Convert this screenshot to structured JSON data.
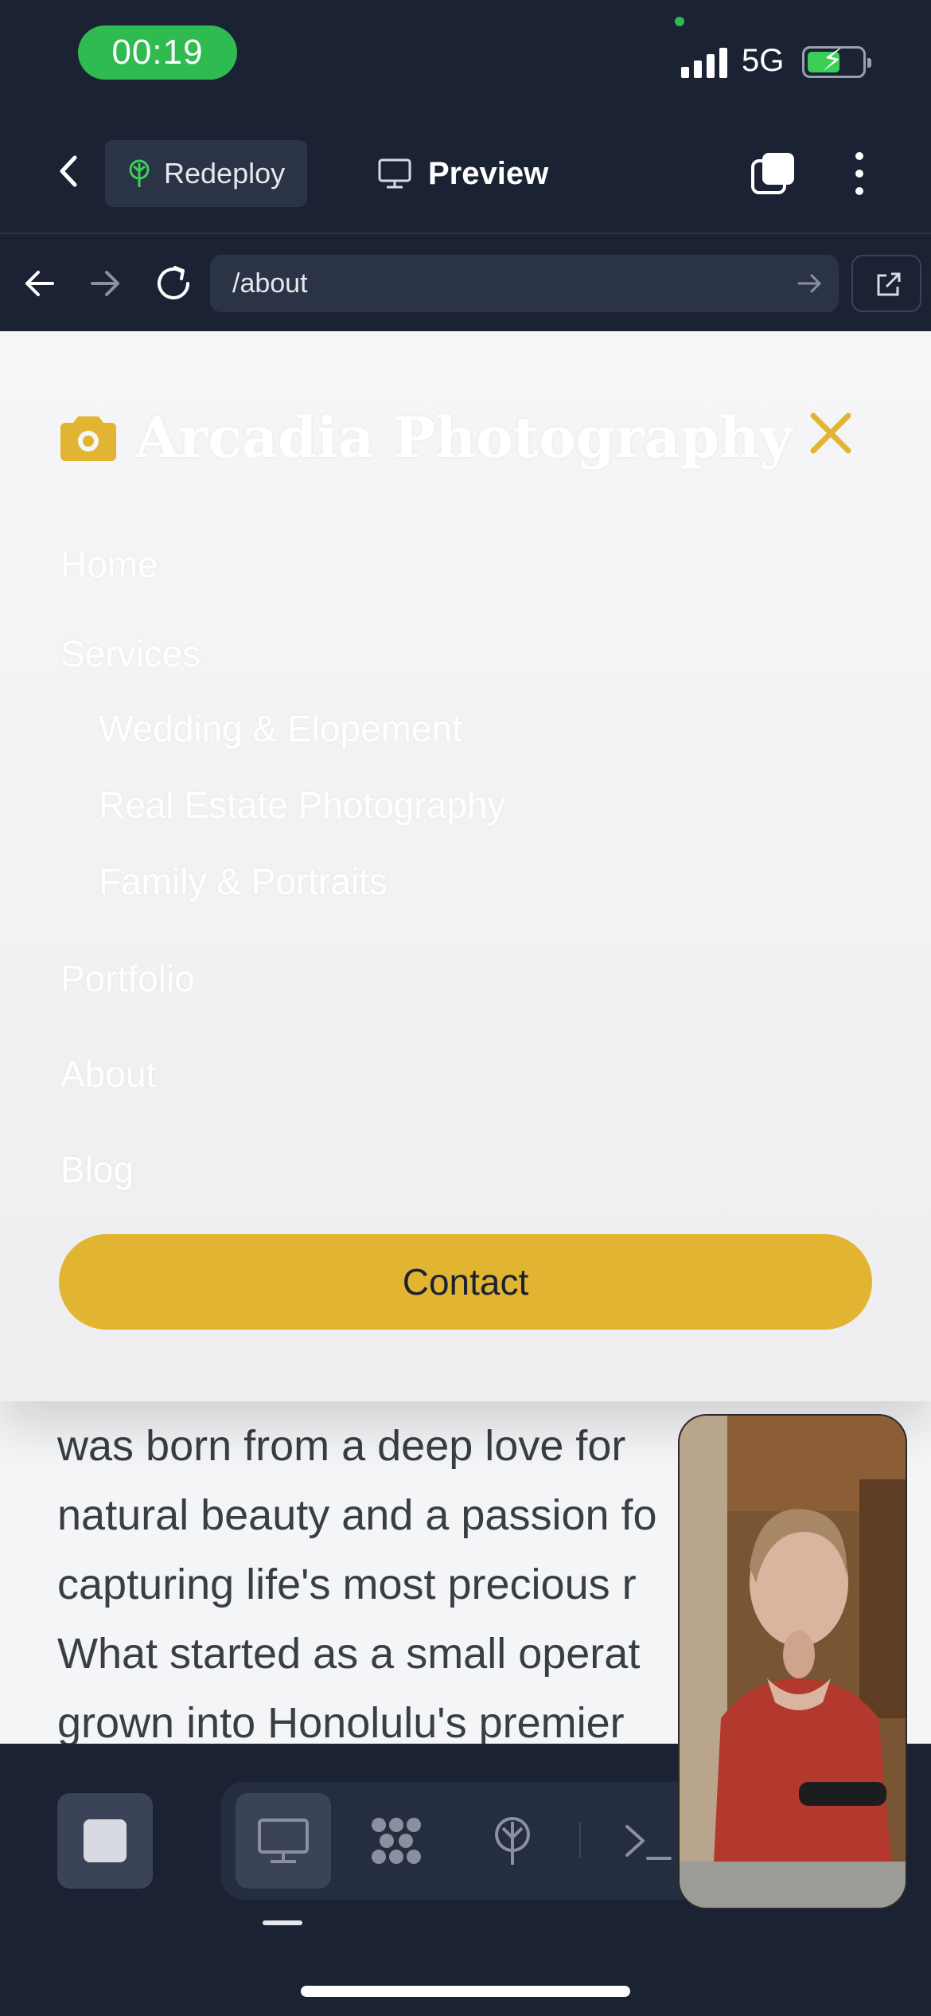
{
  "status_bar": {
    "time": "00:19",
    "network": "5G",
    "battery_level": 0.54
  },
  "toolbar": {
    "redeploy_label": "Redeploy",
    "preview_label": "Preview"
  },
  "browser": {
    "url": "/about"
  },
  "menu": {
    "brand": "Arcadia Photography",
    "items": [
      {
        "label": "Home"
      },
      {
        "label": "Services"
      },
      {
        "label": "Wedding & Elopement"
      },
      {
        "label": "Real Estate Photography"
      },
      {
        "label": "Family & Portraits"
      },
      {
        "label": "Portfolio"
      },
      {
        "label": "About"
      },
      {
        "label": "Blog"
      }
    ],
    "contact_label": "Contact"
  },
  "page": {
    "body_lines": [
      "was born from a deep love for",
      "natural beauty and a passion fo",
      "capturing life's most precious r",
      "What started as a small operat",
      "grown into Honolulu's premier"
    ]
  },
  "colors": {
    "accent": "#e1b531",
    "chrome": "#1b2233",
    "status_green": "#2fbb4f"
  }
}
